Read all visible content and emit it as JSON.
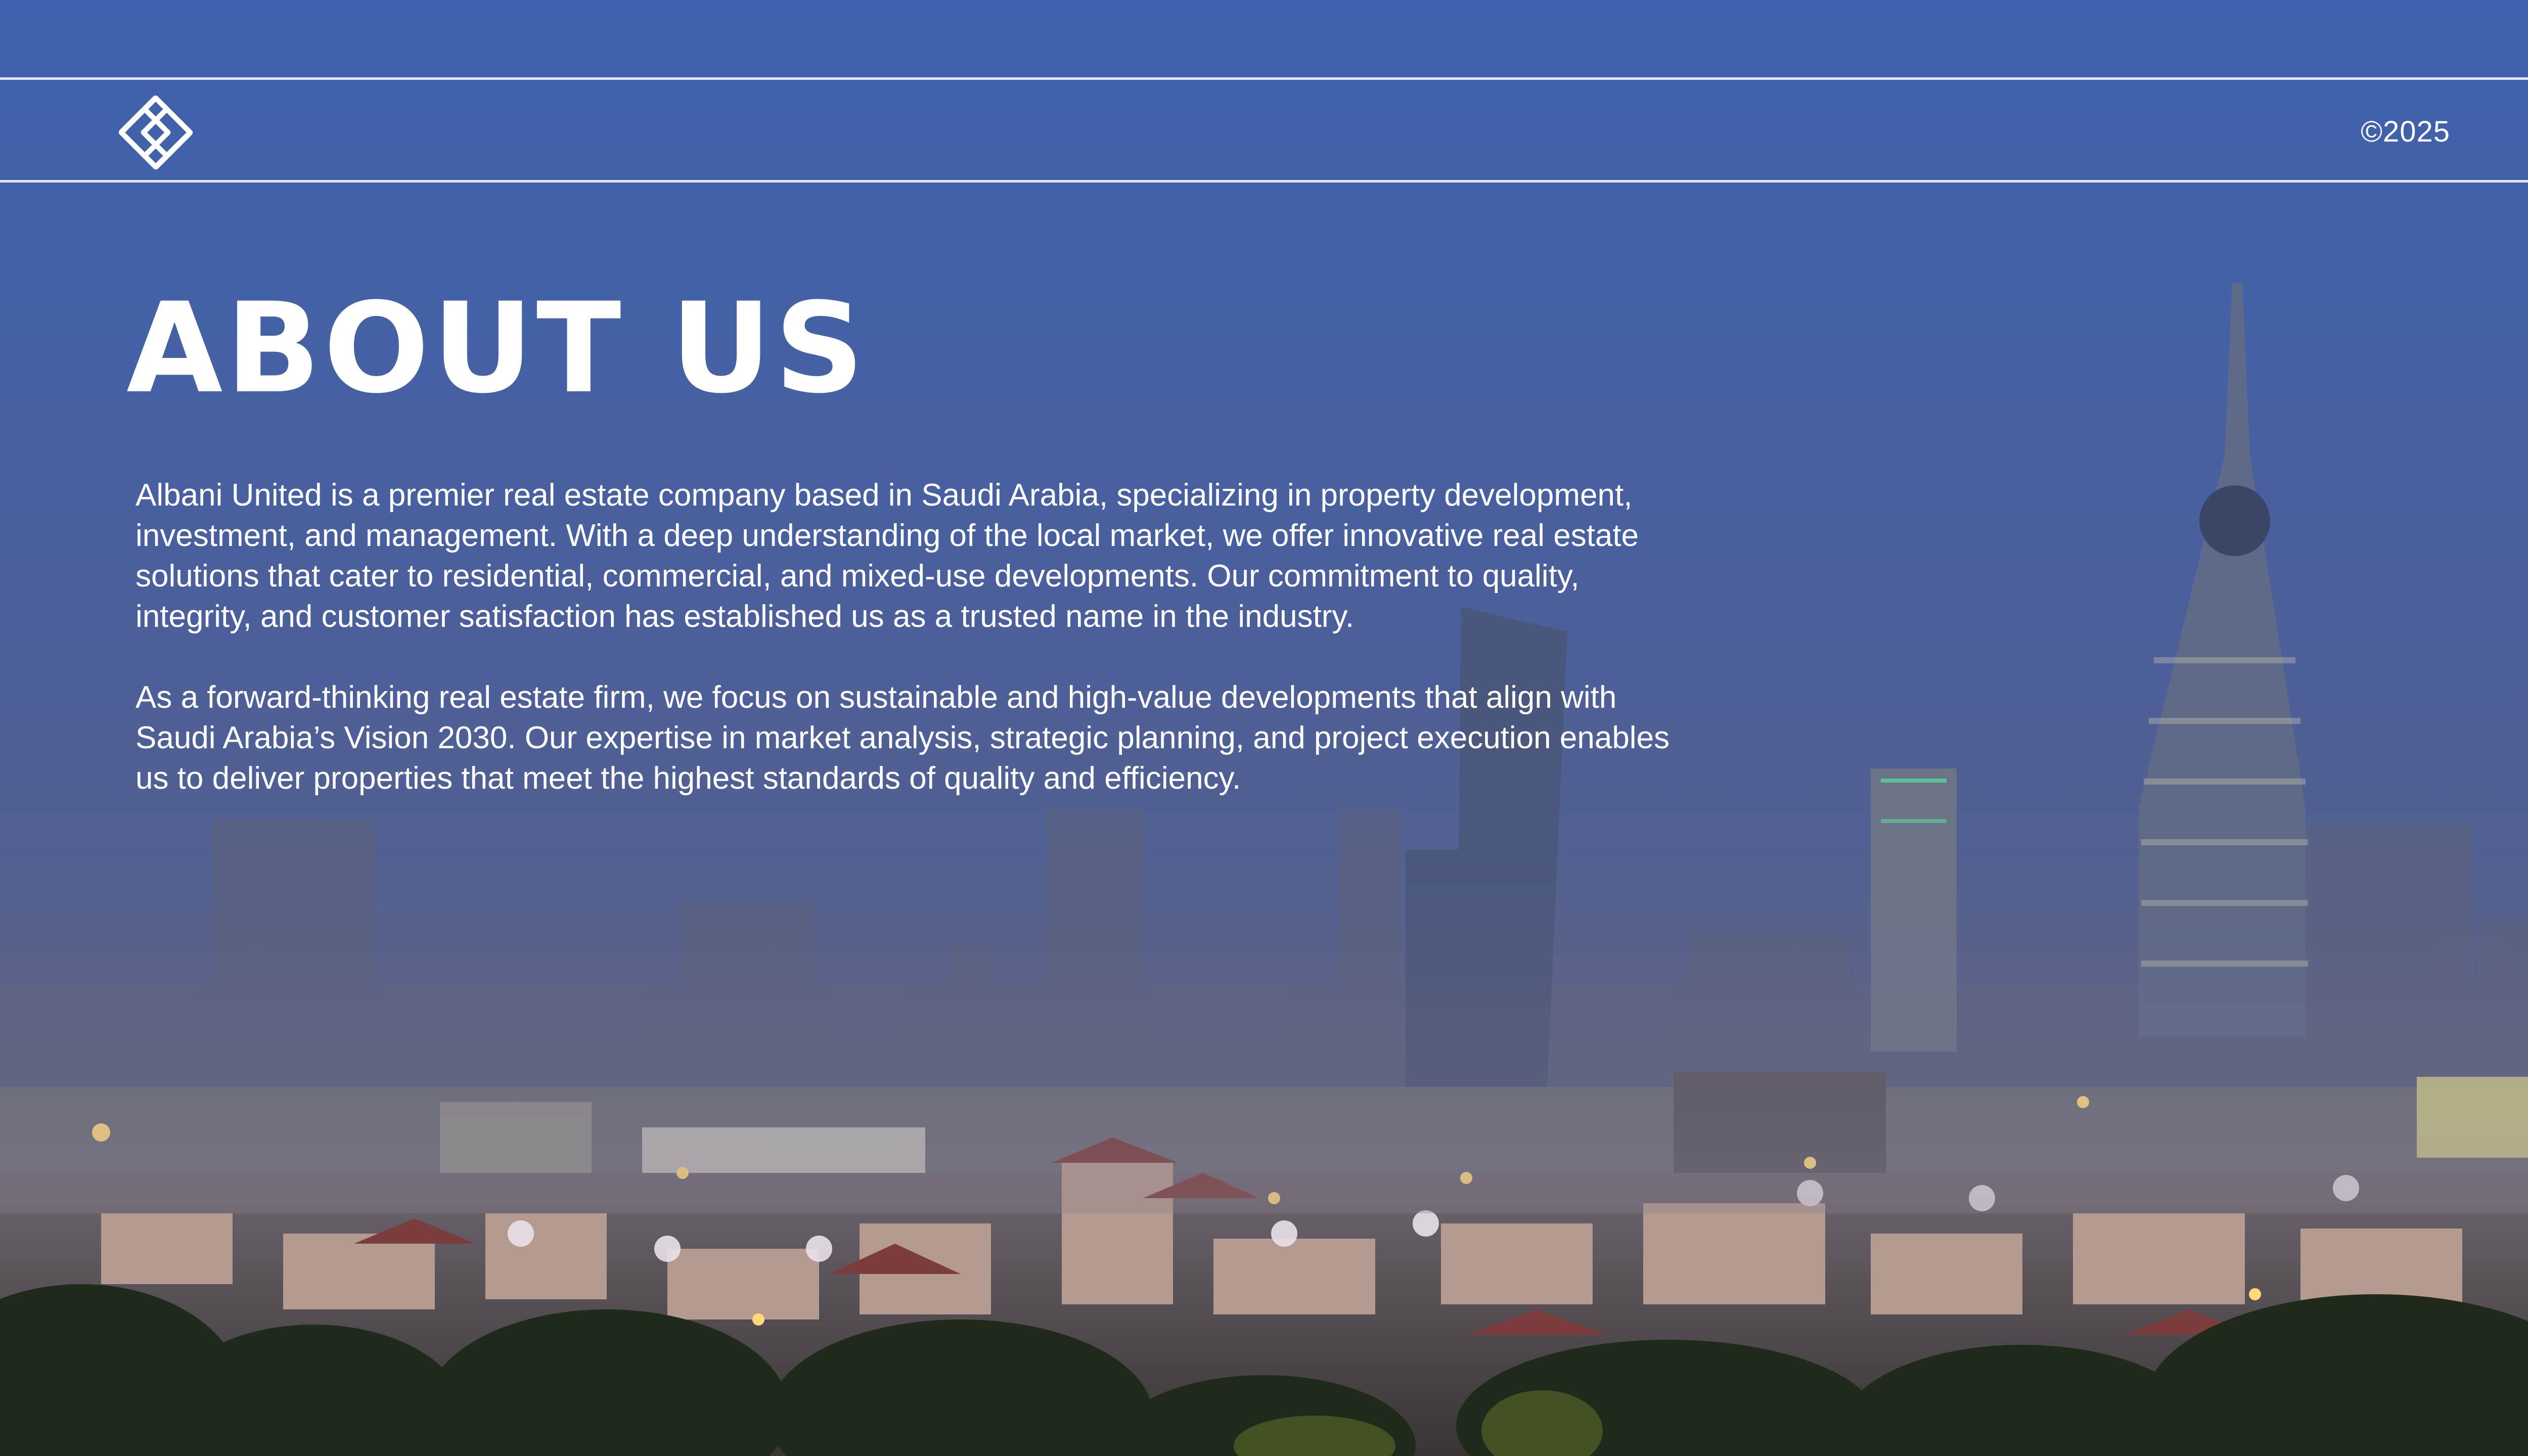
{
  "header": {
    "logo_icon": "albani-logo-icon",
    "year": "©2025"
  },
  "title": "ABOUT US",
  "paragraphs": [
    "Albani United is a premier real estate company based in Saudi Arabia, specializing in property development, investment, and management. With a deep understanding of the local market, we offer innovative real estate solutions that cater to residential, commercial, and mixed-use developments. Our commitment to quality, integrity, and customer satisfaction has established us as a trusted name in the industry.",
    "As a forward-thinking real estate firm, we focus on sustainable and high-value developments that align with Saudi Arabia’s Vision 2030. Our expertise in market analysis, strategic planning, and project execution enables us to deliver properties that meet the highest standards of quality and efficiency."
  ],
  "colors": {
    "sky_top": "#3e62ad",
    "sky_bottom": "#5b5f80",
    "text": "#ffffff",
    "rule": "#e6e9f2"
  }
}
